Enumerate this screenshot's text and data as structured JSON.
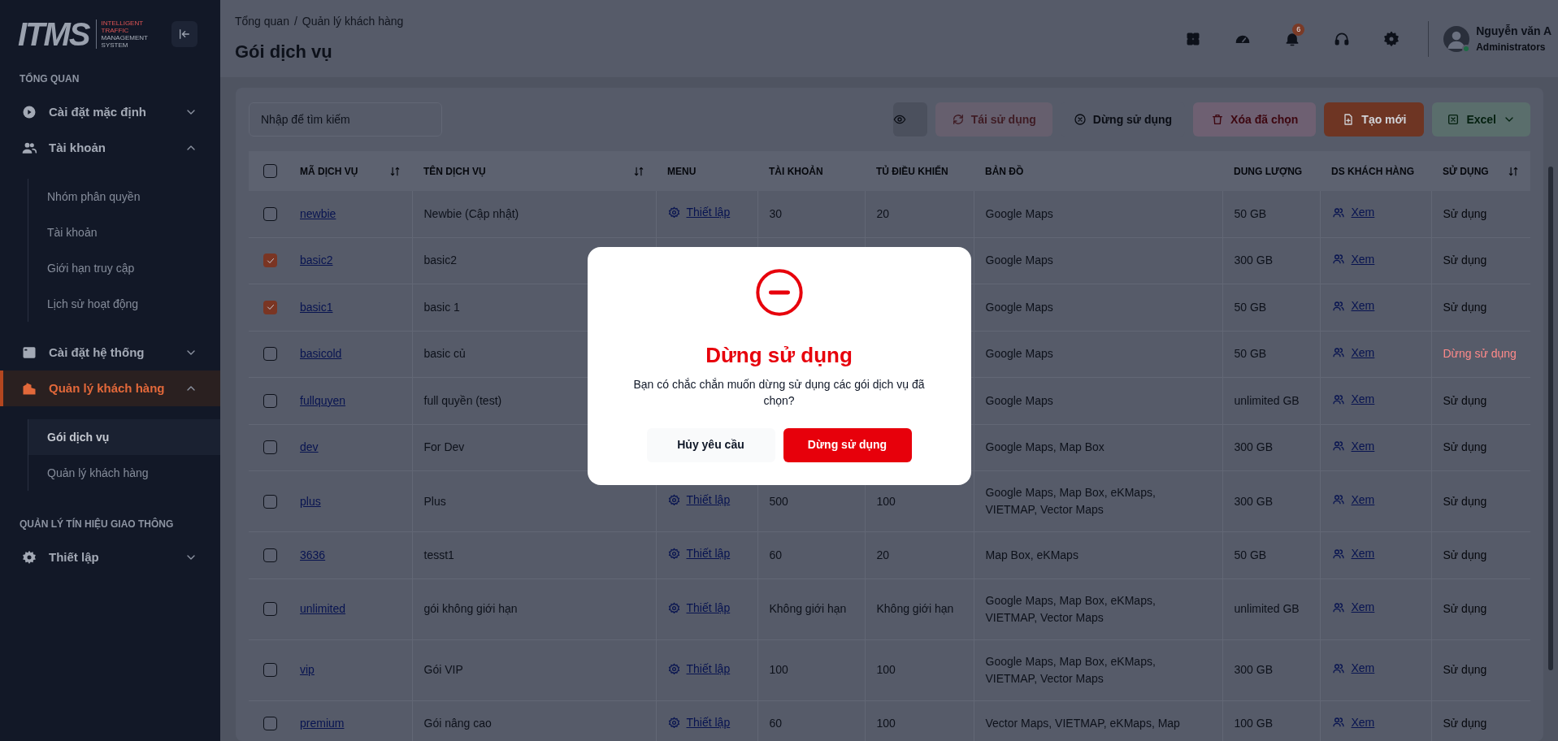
{
  "sidebar": {
    "logo": {
      "mark": "ITMS",
      "tagline": [
        "INTELLIGENT",
        "TRAFFIC",
        "MANAGEMENT",
        "SYSTEM"
      ]
    },
    "sections": [
      {
        "heading": "TỔNG QUAN",
        "items": [
          {
            "label": "Cài đặt mặc định",
            "expanded": false,
            "selected": false
          },
          {
            "label": "Tài khoản",
            "expanded": true,
            "selected": false,
            "children": [
              {
                "label": "Nhóm phân quyền",
                "selected": false
              },
              {
                "label": "Tài khoản",
                "selected": false
              },
              {
                "label": "Giới hạn truy cập",
                "selected": false
              },
              {
                "label": "Lịch sử hoạt động",
                "selected": false
              }
            ]
          },
          {
            "label": "Cài đặt hệ thống",
            "expanded": false,
            "selected": false
          },
          {
            "label": "Quản lý khách hàng",
            "expanded": true,
            "selected": true,
            "children": [
              {
                "label": "Gói dịch vụ",
                "selected": true
              },
              {
                "label": "Quản lý khách hàng",
                "selected": false
              }
            ]
          }
        ]
      },
      {
        "heading": "QUẢN LÝ TÍN HIỆU GIAO THÔNG",
        "items": [
          {
            "label": "Thiết lập",
            "expanded": false,
            "selected": false
          }
        ]
      }
    ]
  },
  "header": {
    "breadcrumb": [
      "Tổng quan",
      "Quản lý khách hàng"
    ],
    "separator": "/",
    "title": "Gói dịch vụ",
    "notification_count": "6",
    "user": {
      "name": "Nguyễn văn A",
      "role": "Administrators",
      "online": true
    }
  },
  "toolbar": {
    "search": {
      "placeholder": "Nhập để tìm kiếm"
    },
    "buttons": [
      {
        "kind": "view",
        "disabled": false
      },
      {
        "kind": "reuse",
        "label": "Tái sử dụng",
        "disabled": true
      },
      {
        "kind": "stop",
        "label": "Dừng sử dụng",
        "disabled": false
      },
      {
        "kind": "delete",
        "label": "Xóa đã chọn",
        "disabled": false
      },
      {
        "kind": "create",
        "label": "Tạo mới",
        "disabled": false
      },
      {
        "kind": "excel",
        "label": "Excel",
        "disabled": false
      }
    ]
  },
  "table": {
    "select_all": {
      "checked": false
    },
    "columns": [
      {
        "label": "MÃ DỊCH VỤ",
        "sortable": true
      },
      {
        "label": "TÊN DỊCH VỤ",
        "sortable": true
      },
      {
        "label": "MENU",
        "sortable": false
      },
      {
        "label": "TÀI KHOẢN",
        "sortable": false
      },
      {
        "label": "TỦ ĐIỀU KHIỂN",
        "sortable": false
      },
      {
        "label": "BẢN ĐỒ",
        "sortable": false
      },
      {
        "label": "DUNG LƯỢNG",
        "sortable": false
      },
      {
        "label": "DS KHÁCH HÀNG",
        "sortable": false
      },
      {
        "label": "SỬ DỤNG",
        "sortable": true
      }
    ],
    "rows": [
      {
        "checked": false,
        "code": "newbie",
        "name": "Newbie (Cập nhật)",
        "menu": "Thiết lập",
        "accounts": "30",
        "controllers": "20",
        "maps": "Google Maps",
        "storage": "50 GB",
        "customers": "Xem",
        "status": "Sử dụng",
        "stopped": false
      },
      {
        "checked": true,
        "code": "basic2",
        "name": "basic2",
        "maps": "Google Maps",
        "storage": "300 GB",
        "customers": "Xem",
        "status": "Sử dụng",
        "stopped": false
      },
      {
        "checked": true,
        "code": "basic1",
        "name": "basic 1",
        "maps": "Google Maps",
        "storage": "50 GB",
        "customers": "Xem",
        "status": "Sử dụng",
        "stopped": false
      },
      {
        "checked": false,
        "code": "basicold",
        "name": "basic củ",
        "maps": "Google Maps",
        "storage": "50 GB",
        "customers": "Xem",
        "status": "Dừng sử dụng",
        "stopped": true
      },
      {
        "checked": false,
        "code": "fullquyen",
        "name": "full quyền (test)",
        "maps": "Google Maps",
        "storage": "unlimited GB",
        "customers": "Xem",
        "status": "Sử dụng",
        "stopped": false
      },
      {
        "checked": false,
        "code": "dev",
        "name": "For Dev",
        "maps": "Google Maps, Map Box",
        "storage": "300 GB",
        "customers": "Xem",
        "status": "Sử dụng",
        "stopped": false
      },
      {
        "checked": false,
        "code": "plus",
        "name": "Plus",
        "menu": "Thiết lập",
        "accounts": "500",
        "controllers": "100",
        "maps": "Google Maps, Map Box, eKMaps, VIETMAP, Vector Maps",
        "storage": "300 GB",
        "customers": "Xem",
        "status": "Sử dụng",
        "stopped": false
      },
      {
        "checked": false,
        "code": "3636",
        "name": "tesst1",
        "menu": "Thiết lập",
        "accounts": "60",
        "controllers": "20",
        "maps": "Map Box, eKMaps",
        "storage": "50 GB",
        "customers": "Xem",
        "status": "Sử dụng",
        "stopped": false
      },
      {
        "checked": false,
        "code": "unlimited",
        "name": "gói không giới hạn",
        "menu": "Thiết lập",
        "accounts": "Không giới hạn",
        "controllers": "Không giới hạn",
        "maps": "Google Maps, Map Box, eKMaps, VIETMAP, Vector Maps",
        "storage": "unlimited GB",
        "customers": "Xem",
        "status": "Sử dụng",
        "stopped": false
      },
      {
        "checked": false,
        "code": "vip",
        "name": "Gói VIP",
        "menu": "Thiết lập",
        "accounts": "100",
        "controllers": "100",
        "maps": "Google Maps, Map Box, eKMaps, VIETMAP, Vector Maps",
        "storage": "300 GB",
        "customers": "Xem",
        "status": "Sử dụng",
        "stopped": false
      },
      {
        "checked": false,
        "code": "premium",
        "name": "Gói nâng cao",
        "menu": "Thiết lập",
        "accounts": "60",
        "controllers": "100",
        "maps": "Vector Maps, VIETMAP, eKMaps, Map",
        "storage": "100 GB",
        "customers": "Xem",
        "status": "Sử dụng",
        "stopped": false
      }
    ]
  },
  "modal": {
    "title": "Dừng sử dụng",
    "message": "Bạn có chắc chắn muốn dừng sử dụng các gói dịch vụ đã chọn?",
    "buttons": [
      {
        "kind": "cancel",
        "label": "Hủy yêu cầu"
      },
      {
        "kind": "confirm",
        "label": "Dừng sử dụng"
      }
    ]
  }
}
